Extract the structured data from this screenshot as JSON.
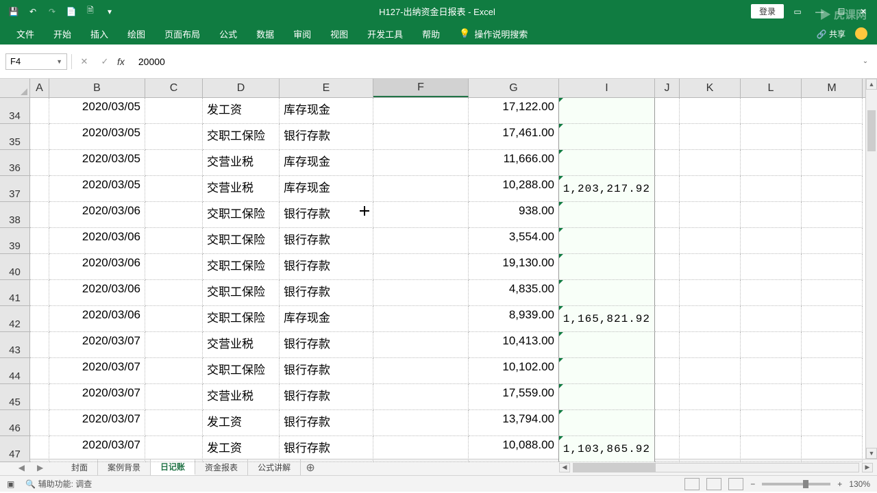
{
  "app": {
    "title": "H127-出纳资金日报表 - Excel",
    "watermark": "▶ 虎课网"
  },
  "qat": {
    "save": "💾",
    "undo": "↶",
    "redo": "↷",
    "touch": "📄",
    "preview": "🗎",
    "more": "▾"
  },
  "titleRight": {
    "login": "登录",
    "ribbonMode": "▭",
    "minimize": "—",
    "maximize": "☐",
    "close": "✕"
  },
  "ribbon": {
    "tabs": [
      "文件",
      "开始",
      "插入",
      "绘图",
      "页面布局",
      "公式",
      "数据",
      "审阅",
      "视图",
      "开发工具",
      "帮助"
    ],
    "tellMe": "操作说明搜索",
    "share": "共享"
  },
  "formulaBar": {
    "nameBox": "F4",
    "value": "20000"
  },
  "columns": [
    "A",
    "B",
    "C",
    "D",
    "E",
    "F",
    "G",
    "I",
    "J",
    "K",
    "L",
    "M"
  ],
  "selectedCol": "F",
  "rows": [
    {
      "n": 34,
      "b": "2020/03/05",
      "d": "发工资",
      "e": "库存现金",
      "g": "17,122.00",
      "i": ""
    },
    {
      "n": 35,
      "b": "2020/03/05",
      "d": "交职工保险",
      "e": "银行存款",
      "g": "17,461.00",
      "i": ""
    },
    {
      "n": 36,
      "b": "2020/03/05",
      "d": "交营业税",
      "e": "库存现金",
      "g": "11,666.00",
      "i": ""
    },
    {
      "n": 37,
      "b": "2020/03/05",
      "d": "交营业税",
      "e": "库存现金",
      "g": "10,288.00",
      "i": "1,203,217.92"
    },
    {
      "n": 38,
      "b": "2020/03/06",
      "d": "交职工保险",
      "e": "银行存款",
      "g": "938.00",
      "i": ""
    },
    {
      "n": 39,
      "b": "2020/03/06",
      "d": "交职工保险",
      "e": "银行存款",
      "g": "3,554.00",
      "i": ""
    },
    {
      "n": 40,
      "b": "2020/03/06",
      "d": "交职工保险",
      "e": "银行存款",
      "g": "19,130.00",
      "i": ""
    },
    {
      "n": 41,
      "b": "2020/03/06",
      "d": "交职工保险",
      "e": "银行存款",
      "g": "4,835.00",
      "i": ""
    },
    {
      "n": 42,
      "b": "2020/03/06",
      "d": "交职工保险",
      "e": "库存现金",
      "g": "8,939.00",
      "i": "1,165,821.92"
    },
    {
      "n": 43,
      "b": "2020/03/07",
      "d": "交营业税",
      "e": "银行存款",
      "g": "10,413.00",
      "i": ""
    },
    {
      "n": 44,
      "b": "2020/03/07",
      "d": "交职工保险",
      "e": "银行存款",
      "g": "10,102.00",
      "i": ""
    },
    {
      "n": 45,
      "b": "2020/03/07",
      "d": "交营业税",
      "e": "银行存款",
      "g": "17,559.00",
      "i": ""
    },
    {
      "n": 46,
      "b": "2020/03/07",
      "d": "发工资",
      "e": "银行存款",
      "g": "13,794.00",
      "i": ""
    },
    {
      "n": 47,
      "b": "2020/03/07",
      "d": "发工资",
      "e": "银行存款",
      "g": "10,088.00",
      "i": "1,103,865.92"
    }
  ],
  "sheets": {
    "items": [
      "封面",
      "案例背景",
      "日记账",
      "资金报表",
      "公式讲解"
    ],
    "active": "日记账"
  },
  "statusbar": {
    "accessibility": "辅助功能: 调查",
    "zoom": "130%"
  }
}
